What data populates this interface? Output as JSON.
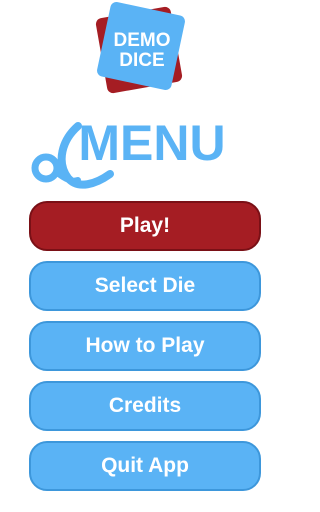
{
  "logo": {
    "line1": "DEMO",
    "line2": "DICE",
    "front_color": "#5ab3f5",
    "back_color": "#a51d23"
  },
  "menu_title": {
    "text": "MENU",
    "color": "#5ab3f5"
  },
  "buttons": {
    "play_label": "Play!",
    "select_die_label": "Select Die",
    "how_to_play_label": "How to Play",
    "credits_label": "Credits",
    "quit_label": "Quit App"
  },
  "colors": {
    "primary_button": "#a51d23",
    "secondary_button": "#5ab3f5",
    "button_text": "#ffffff"
  }
}
